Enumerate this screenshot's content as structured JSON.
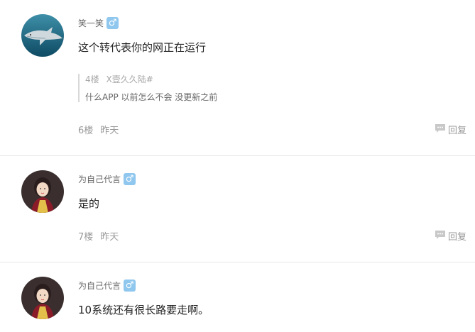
{
  "posts": [
    {
      "username": "笑一笑",
      "gender_icon": "male-icon",
      "gender_symbol": "♂",
      "content": "这个转代表你的网正在运行",
      "quote": {
        "floor": "4楼",
        "author": "X壹久久陆#",
        "text": "什么APP 以前怎么不会 没更新之前"
      },
      "floor": "6楼",
      "time": "昨天",
      "reply_label": "回复"
    },
    {
      "username": "为自己代言",
      "gender_icon": "male-icon",
      "gender_symbol": "♂",
      "content": "是的",
      "floor": "7楼",
      "time": "昨天",
      "reply_label": "回复"
    },
    {
      "username": "为自己代言",
      "gender_icon": "male-icon",
      "gender_symbol": "♂",
      "content": "10系统还有很长路要走啊。"
    }
  ],
  "colors": {
    "gender_badge": "#8fc7ee",
    "divider": "#e8e8e8",
    "meta_text": "#999999"
  }
}
